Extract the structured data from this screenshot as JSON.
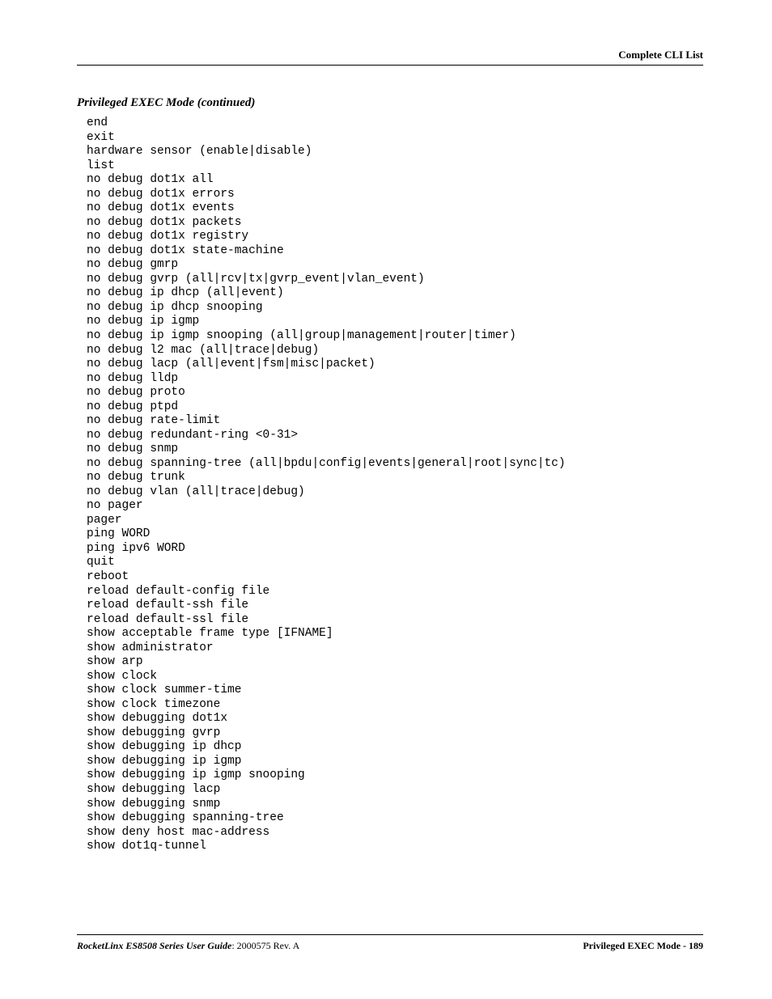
{
  "header": {
    "right": "Complete CLI List"
  },
  "section": {
    "title": "Privileged EXEC Mode (continued)"
  },
  "cli_lines": [
    "end",
    "exit",
    "hardware sensor (enable|disable)",
    "list",
    "no debug dot1x all",
    "no debug dot1x errors",
    "no debug dot1x events",
    "no debug dot1x packets",
    "no debug dot1x registry",
    "no debug dot1x state-machine",
    "no debug gmrp",
    "no debug gvrp (all|rcv|tx|gvrp_event|vlan_event)",
    "no debug ip dhcp (all|event)",
    "no debug ip dhcp snooping",
    "no debug ip igmp",
    "no debug ip igmp snooping (all|group|management|router|timer)",
    "no debug l2 mac (all|trace|debug)",
    "no debug lacp (all|event|fsm|misc|packet)",
    "no debug lldp",
    "no debug proto",
    "no debug ptpd",
    "no debug rate-limit",
    "no debug redundant-ring <0-31>",
    "no debug snmp",
    "no debug spanning-tree (all|bpdu|config|events|general|root|sync|tc)",
    "no debug trunk",
    "no debug vlan (all|trace|debug)",
    "no pager",
    "pager",
    "ping WORD",
    "ping ipv6 WORD",
    "quit",
    "reboot",
    "reload default-config file",
    "reload default-ssh file",
    "reload default-ssl file",
    "show acceptable frame type [IFNAME]",
    "show administrator",
    "show arp",
    "show clock",
    "show clock summer-time",
    "show clock timezone",
    "show debugging dot1x",
    "show debugging gvrp",
    "show debugging ip dhcp",
    "show debugging ip igmp",
    "show debugging ip igmp snooping",
    "show debugging lacp",
    "show debugging snmp",
    "show debugging spanning-tree",
    "show deny host mac-address",
    "show dot1q-tunnel"
  ],
  "footer": {
    "doc_title": "RocketLinx ES8508 Series  User Guide",
    "doc_rev": ": 2000575 Rev. A",
    "right": "Privileged EXEC Mode - 189"
  }
}
